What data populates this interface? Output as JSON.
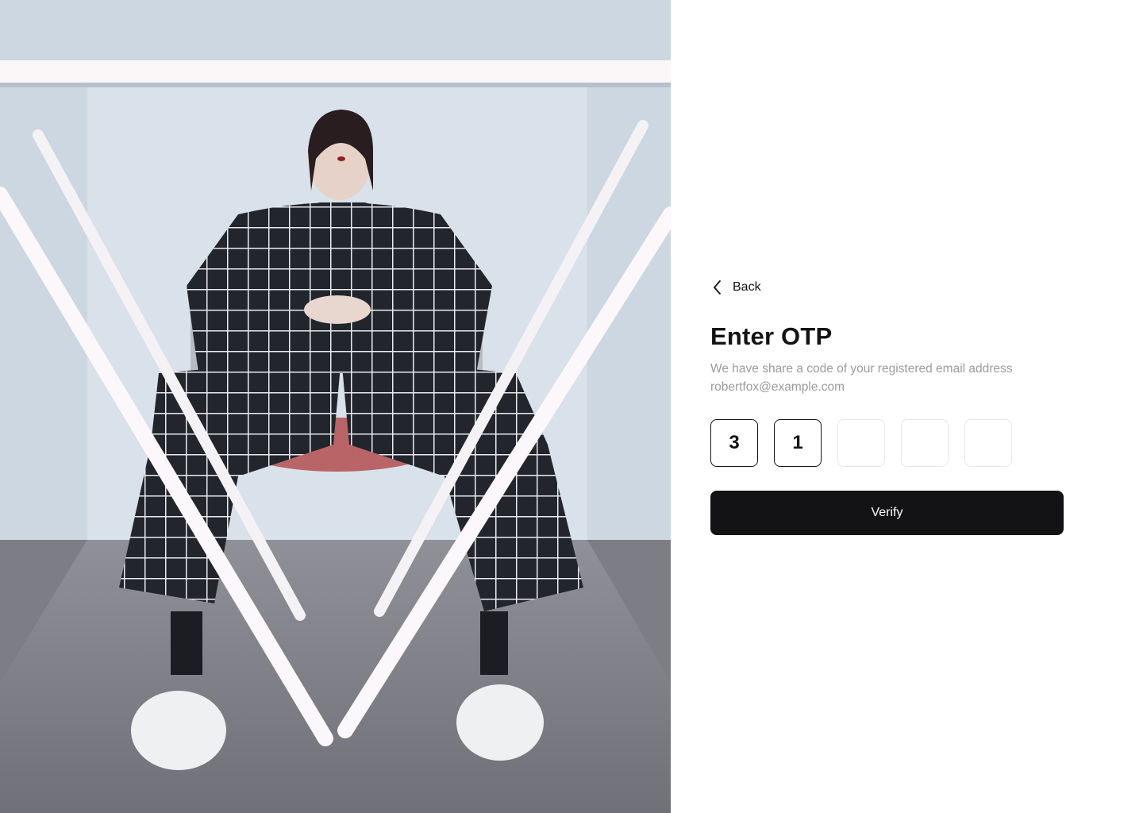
{
  "back": {
    "label": "Back"
  },
  "title": "Enter OTP",
  "subtitle": {
    "line1": "We have share a code of your registered email address",
    "email": "robertfox@example.com"
  },
  "otp": {
    "digits": [
      "3",
      "1",
      "",
      "",
      ""
    ]
  },
  "verify_button": {
    "label": "Verify"
  },
  "colors": {
    "primary": "#131316",
    "muted_text": "#9a9aa1",
    "input_border": "#e7e7ea"
  },
  "icons": {
    "back": "chevron-left-icon"
  }
}
